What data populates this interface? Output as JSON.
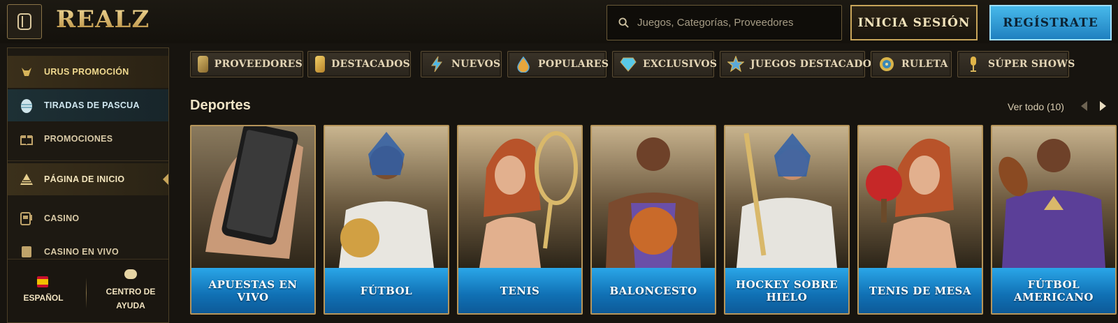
{
  "header": {
    "logo_text": "REALZ",
    "search_placeholder": "Juegos, Categorías, Proveedores",
    "login_label": "INICIA SESIÓN",
    "register_label": "REGÍSTRATE"
  },
  "sidebar": {
    "items": [
      {
        "label": "URUS PROMOCIÓN",
        "icon": "bull-icon"
      },
      {
        "label": "TIRADAS DE PASCUA",
        "icon": "easter-egg-icon"
      },
      {
        "label": "PROMOCIONES",
        "icon": "gift-icon"
      },
      {
        "label": "PÁGINA DE INICIO",
        "icon": "pyramid-home-icon"
      },
      {
        "label": "CASINO",
        "icon": "slot-machine-icon"
      },
      {
        "label": "CASINO EN VIVO",
        "icon": "live-casino-icon"
      }
    ],
    "footer": {
      "language": "ESPAÑOL",
      "help": "CENTRO DE AYUDA"
    }
  },
  "categories": [
    {
      "label": "PROVEEDORES",
      "icon": "scroll-icon",
      "color": "#c9a85a"
    },
    {
      "label": "DESTACADOS",
      "icon": "gold-bars-icon",
      "color": "#d9a53a"
    },
    {
      "label": "NUEVOS",
      "icon": "lightning-icon",
      "color": "#4ab6e8"
    },
    {
      "label": "POPULARES",
      "icon": "drop-icon",
      "color": "#e6a63c"
    },
    {
      "label": "EXCLUSIVOS",
      "icon": "diamond-icon",
      "color": "#58c9e8"
    },
    {
      "label": "JUEGOS DESTACADOS",
      "icon": "star-icon",
      "color": "#5aa9d8"
    },
    {
      "label": "RULETA",
      "icon": "roulette-icon",
      "color": "#d9b44a"
    },
    {
      "label": "SÚPER SHOWS",
      "icon": "microphone-icon",
      "color": "#e0b448"
    }
  ],
  "section": {
    "title": "Deportes",
    "view_all": "Ver todo (10)"
  },
  "cards": [
    {
      "label": "APUESTAS EN VIVO",
      "icon": "phone-betting-icon"
    },
    {
      "label": "FÚTBOL",
      "icon": "soccer-ball-icon"
    },
    {
      "label": "TENIS",
      "icon": "tennis-racket-icon"
    },
    {
      "label": "BALONCESTO",
      "icon": "basketball-icon"
    },
    {
      "label": "HOCKEY SOBRE HIELO",
      "icon": "hockey-stick-icon"
    },
    {
      "label": "TENIS DE MESA",
      "icon": "ping-pong-paddle-icon"
    },
    {
      "label": "FÚTBOL AMERICANO",
      "icon": "american-football-icon"
    }
  ]
}
